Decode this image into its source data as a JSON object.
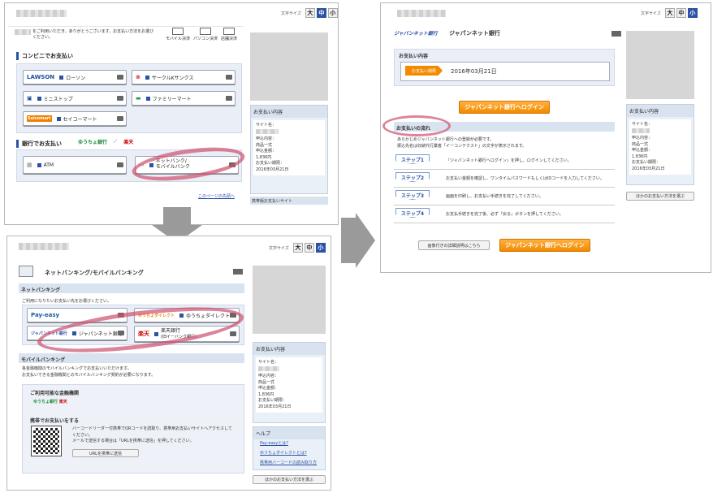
{
  "fontsize": {
    "label": "文字サイズ",
    "large": "大",
    "medium": "中",
    "small": "小"
  },
  "p1": {
    "intro": "をご利用いただき、ありがとうございます。お支払い方法をお選びください。",
    "tabs": [
      "モバイル決済",
      "パソコン決済",
      "店舗決済"
    ],
    "conv_title": "コンビニでお支払い",
    "lawson_logo": "LAWSON",
    "lawson": "ローソン",
    "circlek": "サークルKサンクス",
    "ministop": "ミニストップ",
    "familymart": "ファミリーマート",
    "seicomart_logo": "Seicomart",
    "seicomart": "セイコーマート",
    "bank_title": "銀行でお支払い",
    "yucho": "ゆうちょ銀行",
    "rakuten": "楽天",
    "atm": "ATM",
    "netbank": "ネットバンク/\nモバイルバンク",
    "side": {
      "title": "お支払い内容",
      "site": "サイト名：",
      "content_label": "申込内容：",
      "content": "商品一式",
      "amount_label": "申込金額：",
      "amount": "1,836円",
      "deadline_label": "お支払い期限：",
      "deadline": "2016年03月21日"
    },
    "mobile_site": "携帯版お支払いサイト",
    "top_link": "このページの先頭へ"
  },
  "p2": {
    "title": "ネットバンキング/モバイルバンキング",
    "nb_head": "ネットバンキング",
    "nb_desc": "ご利用になりたいお支払い先をお選びください。",
    "payeasy": "Pay-easy",
    "japannet_logo": "ジャパンネット銀行",
    "japannet": "ジャパンネット銀行",
    "yucho_direct_logo": "ゆうちょダイレクト",
    "yucho_direct": "ゆうちょダイレクト",
    "rakuten_logo": "楽天",
    "rakuten_bank": "楽天銀行",
    "rakuten_sub": "(旧イーバンク銀行)",
    "mb_head": "モバイルバンキング",
    "mb_desc1": "各金融機関のモバイルバンキングでお支払いいただけます。",
    "mb_desc2": "お支払いできる金融機関とのモバイルバンキング契約が必要になります。",
    "usable": "ご利用可能な金融機関",
    "mobile_pay": "携帯でお支払いをする",
    "qr_desc1": "バーコードリーダー付携帯でQRコードを読取り、携帯用お支払いサイトへアクセスしてください。",
    "qr_desc2": "メールで送信する場合は「URLを携帯に送信」を押してください。",
    "send_url": "URLを携帯に送信",
    "side": {
      "title": "お支払い内容",
      "site": "サイト名：",
      "content_label": "申込内容：",
      "content": "商品一式",
      "amount_label": "申込金額：",
      "amount": "1,836円",
      "deadline_label": "お支払い期限：",
      "deadline": "2016年03月21日"
    },
    "help": "ヘルプ",
    "help_links": [
      "Pay-easyとは?",
      "ゆうちょダイレクトとは?",
      "携帯用バーコードの読み取り方"
    ],
    "other": "ほかのお支払い方法を選ぶ"
  },
  "p3": {
    "bank_logo": "ジャパンネット銀行",
    "bank_name": "ジャパンネット銀行",
    "content_title": "お支払い内容",
    "deadline_tag": "お支払い期限",
    "deadline": "2016年03月21日",
    "login": "ジャパンネット銀行へログイン",
    "flow_title": "お支払いの流れ",
    "flow_note1": "あらかじめジャパンネット銀行への登録が必要です。",
    "flow_note2": "振込先名は収納代行業者「イーコンテクスト」の文字が表示されます。",
    "steps": [
      {
        "label": "ステップ1",
        "text": "『ジャパンネット銀行へログイン』を押し、ログインしてください。"
      },
      {
        "label": "ステップ2",
        "text": "お支払い金額を確認し、ワンタイムパスワードもしくはIDコードを入力してください。"
      },
      {
        "label": "ステップ3",
        "text": "画面を印刷し、お支払い手続きを完了してください。"
      },
      {
        "label": "ステップ4",
        "text": "お支払手続きを完了後、必ず『戻る』ボタンを押してください。"
      }
    ],
    "detail": "画像付きの詳細説明はこちら",
    "side": {
      "title": "お支払い内容",
      "site": "サイト名：",
      "content_label": "申込内容：",
      "content": "商品一式",
      "amount_label": "申込金額：",
      "amount": "1,836円",
      "deadline_label": "お支払い期限：",
      "deadline": "2016年03月21日"
    },
    "other": "ほかのお支払い方法を選ぶ"
  }
}
